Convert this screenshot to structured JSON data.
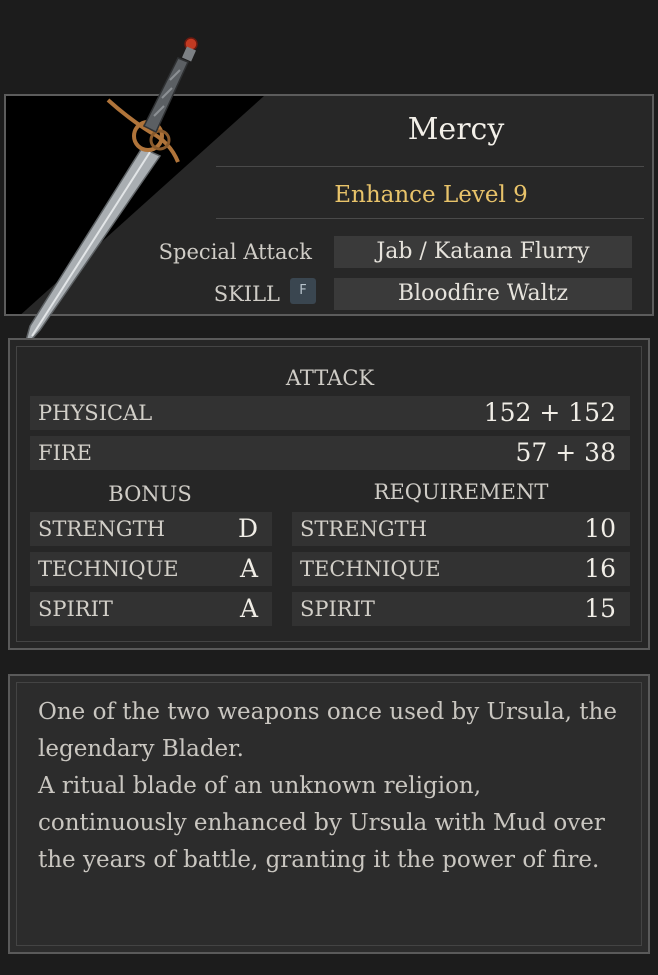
{
  "item": {
    "name": "Mercy",
    "enhance": "Enhance Level 9",
    "special_attack_label": "Special Attack",
    "special_attack_value": "Jab / Katana Flurry",
    "skill_label": "SKILL",
    "skill_key": "F",
    "skill_value": "Bloodfire Waltz"
  },
  "attack": {
    "heading": "ATTACK",
    "rows": [
      {
        "label": "PHYSICAL",
        "value": "152 + 152"
      },
      {
        "label": "FIRE",
        "value": "57 + 38"
      }
    ]
  },
  "bonus": {
    "heading": "BONUS",
    "rows": [
      {
        "label": "STRENGTH",
        "value": "D"
      },
      {
        "label": "TECHNIQUE",
        "value": "A"
      },
      {
        "label": "SPIRIT",
        "value": "A"
      }
    ]
  },
  "requirement": {
    "heading": "REQUIREMENT",
    "rows": [
      {
        "label": "STRENGTH",
        "value": "10"
      },
      {
        "label": "TECHNIQUE",
        "value": "16"
      },
      {
        "label": "SPIRIT",
        "value": "15"
      }
    ]
  },
  "description": {
    "line1": "One of the two weapons once used by Ursula, the",
    "line2": "legendary Blader.",
    "line3": "A ritual blade of an unknown religion,",
    "line4": "continuously enhanced by Ursula with Mud over",
    "line5": "the years of battle, granting it the power of fire."
  },
  "colors": {
    "enhance_gold": "#e8c36a",
    "panel_bg": "#262626",
    "row_bg": "#323232"
  },
  "icons": {
    "weapon": "sword-icon",
    "key": "f-key-icon"
  }
}
